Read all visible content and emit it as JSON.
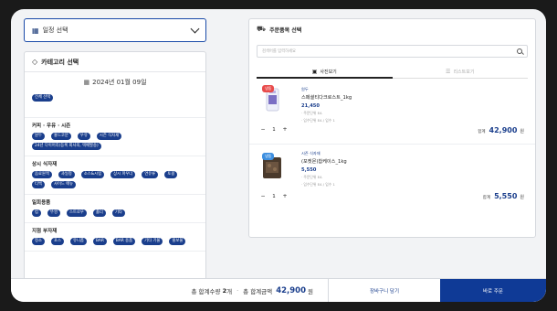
{
  "date_select": {
    "label": "일정 선택"
  },
  "category_panel": {
    "title": "카테고리 선택",
    "date": "2024년 01월 09일",
    "all_label": "전체 선택",
    "groups": [
      {
        "title": "커피 · 우유 · 시즌",
        "items": [
          "원두",
          "홍드코분",
          "우유",
          "시즌 식자재",
          "24년 다이어리(등록 회사의, 택배발송)"
        ]
      },
      {
        "title": "상시 식자재",
        "items": [
          "음료원액",
          "과일청",
          "소스&시럽",
          "상시 파우더",
          "연유류",
          "토핑",
          "티백",
          "사이드 메뉴"
        ]
      },
      {
        "title": "일회용품",
        "items": [
          "컵",
          "뚜껑",
          "스트로우",
          "홀더",
          "기타"
        ]
      },
      {
        "title": "지점 부자재",
        "items": [
          "청소",
          "포스",
          "유니폼",
          "BAR",
          "BAR 용품",
          "기타 기물",
          "홍보물"
        ]
      }
    ]
  },
  "order_panel": {
    "title": "주문품목 선택",
    "search_placeholder": "검색어를 입력하세요",
    "tabs": [
      "사진보기",
      "리스트보기"
    ],
    "items": [
      {
        "badge": "냉동",
        "brand": "원두",
        "name": "스페셜티다크로스트_1kg",
        "price": "21,450",
        "meta1": "· 주문단위 EA",
        "meta2": "· 입수단위 EA / 입수 1",
        "qty": "1",
        "total_label": "합계",
        "total": "42,900",
        "unit": "원"
      },
      {
        "badge": "냉동",
        "brand": "시즌 식자재",
        "name": "(포켓몬)찹케이스_1kg",
        "price": "5,550",
        "meta1": "· 주문단위 EA",
        "meta2": "· 입수단위 EA / 입수 1",
        "qty": "1",
        "total_label": "합계",
        "total": "5,550",
        "unit": "원"
      }
    ]
  },
  "bottom_bar": {
    "qty_label": "총 합계수량",
    "qty": "2",
    "qty_unit": "개",
    "amount_label": "총 합계금액",
    "amount": "42,900",
    "amount_unit": "원",
    "cart_button": "장바구니 담기",
    "order_button": "바로 주문"
  },
  "colors": {
    "accent": "#1a3e8c",
    "primary_button": "#0f3a96",
    "badge_red": "#e84b4b",
    "badge_blue": "#3d8fe0"
  }
}
